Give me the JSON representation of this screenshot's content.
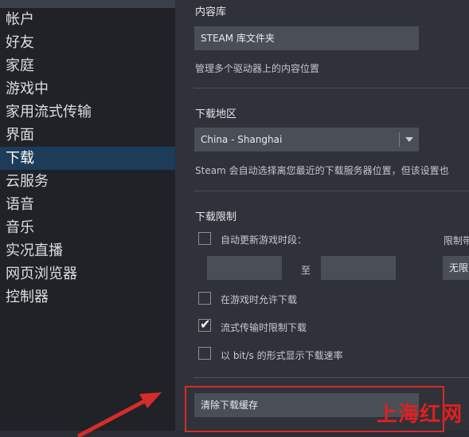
{
  "sidebar": {
    "items": [
      {
        "label": "帐户"
      },
      {
        "label": "好友"
      },
      {
        "label": "家庭"
      },
      {
        "label": "游戏中"
      },
      {
        "label": "家用流式传输"
      },
      {
        "label": "界面"
      },
      {
        "label": "下载"
      },
      {
        "label": "云服务"
      },
      {
        "label": "语音"
      },
      {
        "label": "音乐"
      },
      {
        "label": "实况直播"
      },
      {
        "label": "网页浏览器"
      },
      {
        "label": "控制器"
      }
    ],
    "active_index": 6
  },
  "content_library": {
    "title": "内容库",
    "button_label": "STEAM 库文件夹",
    "description": "管理多个驱动器上的内容位置"
  },
  "download_region": {
    "title": "下载地区",
    "selected": "China - Shanghai",
    "description": "Steam 会自动选择离您最近的下载服务器位置，但该设置也"
  },
  "download_limits": {
    "title": "下载限制",
    "auto_update_label": "自动更新游戏时段：",
    "to_label": "至",
    "limit_bandwidth_label": "限制带",
    "unlimited_label": "无限",
    "allow_during_game_label": "在游戏时允许下载",
    "throttle_streaming_label": "流式传输时限制下载",
    "bits_display_label": "以 bit/s 的形式显示下载速率",
    "auto_update_checked": false,
    "allow_during_game_checked": false,
    "throttle_streaming_checked": true,
    "bits_display_checked": false
  },
  "clear_cache": {
    "button_label": "清除下载缓存"
  },
  "watermark": "上海红网",
  "colors": {
    "accent_red": "#d72b2b",
    "active_sidebar": "#1d3c59"
  }
}
